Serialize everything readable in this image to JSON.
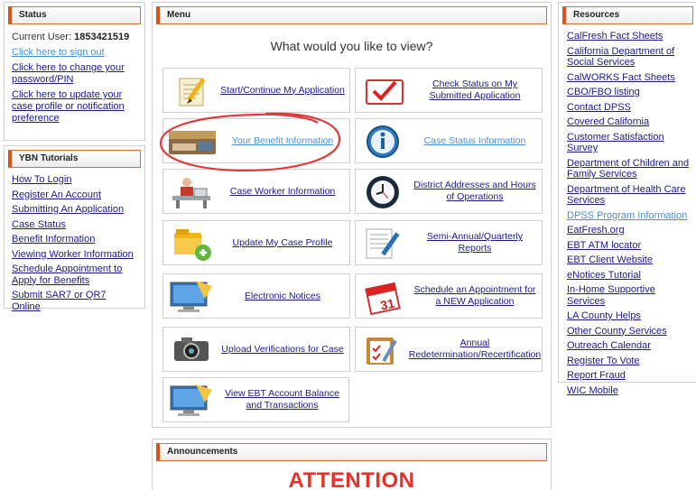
{
  "status": {
    "header": "Status",
    "current_user_label": "Current User:",
    "current_user_id": "1853421519",
    "sign_out": "Click here to sign out",
    "change_password": "Click here to change your password/PIN",
    "update_profile": "Click here to update your case profile or notification preference"
  },
  "tutorials": {
    "header": "YBN Tutorials",
    "items": [
      "How To Login",
      "Register An Account",
      "Submitting An Application",
      "Case Status",
      "Benefit Information",
      "Viewing Worker Information",
      "Schedule Appointment to Apply for Benefits",
      "Submit SAR7 or QR7 Online"
    ]
  },
  "menu": {
    "header": "Menu",
    "prompt": "What would you like to view?",
    "tiles": [
      {
        "label": "Start/Continue My Application",
        "icon": "notepad-pencil-icon"
      },
      {
        "label": "Check Status on My Submitted Application",
        "icon": "checkmark-icon"
      },
      {
        "label": "Your Benefit Information",
        "icon": "ebt-card-icon"
      },
      {
        "label": "Case Status Information",
        "icon": "info-icon"
      },
      {
        "label": "Case Worker Information",
        "icon": "worker-desk-icon"
      },
      {
        "label": "District Addresses and Hours of Operations",
        "icon": "clock-icon"
      },
      {
        "label": "Update My Case Profile",
        "icon": "folder-add-icon"
      },
      {
        "label": "Semi-Annual/Quarterly Reports",
        "icon": "report-pen-icon"
      },
      {
        "label": "Electronic Notices",
        "icon": "computer-notice-icon"
      },
      {
        "label": "Schedule an Appointment for a NEW Application",
        "icon": "calendar-icon"
      },
      {
        "label": "Upload Verifications for Case",
        "icon": "camera-icon"
      },
      {
        "label": "Annual Redetermination/Recertification",
        "icon": "clipboard-pen-icon"
      },
      {
        "label": "View EBT Account Balance and Transactions",
        "icon": "computer-balance-icon"
      }
    ]
  },
  "resources": {
    "header": "Resources",
    "items": [
      "CalFresh Fact Sheets",
      "California Department of Social Services",
      "CalWORKS Fact Sheets",
      "CBO/FBO listing",
      "Contact DPSS",
      "Covered California",
      "Customer Satisfaction Survey",
      "Department of Children and Family Services",
      "Department of Health Care Services",
      "DPSS Program Information",
      "EatFresh.org",
      "EBT ATM locator",
      "EBT Client Website",
      "eNotices Tutorial",
      "In-Home Supportive Services",
      "LA County Helps",
      "Other County Services",
      "Outreach Calendar",
      "Register To Vote",
      "Report Fraud",
      "WIC Mobile"
    ]
  },
  "announcements": {
    "header": "Announcements",
    "attention": "ATTENTION"
  },
  "colors": {
    "header_accent": "#d9531e",
    "link": "#1a1a8c",
    "link_light": "#4a90d9",
    "attention": "#e8312a",
    "annotation_circle": "#e03a3a"
  }
}
